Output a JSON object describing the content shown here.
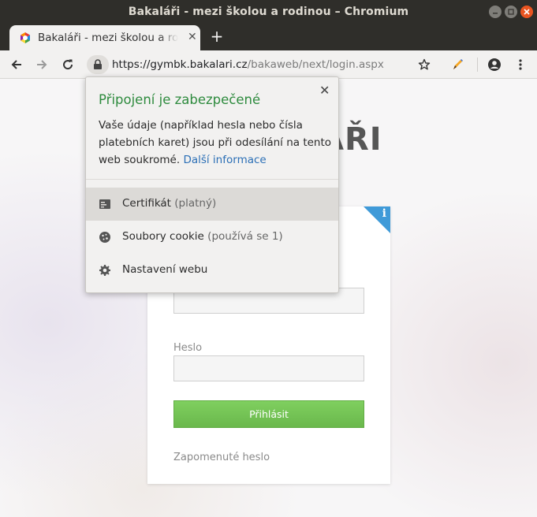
{
  "window": {
    "title": "Bakaláři - mezi školou a rodinou – Chromium"
  },
  "tab": {
    "title": "Bakaláři - mezi školou a rodinou",
    "close": "✕",
    "new_tab": "+"
  },
  "toolbar": {
    "url_host": "https://gymbk.bakalari.cz",
    "url_path": "/bakaweb/next/login.aspx"
  },
  "popup": {
    "title": "Připojení je zabezpečené",
    "close": "✕",
    "description": "Vaše údaje (například hesla nebo čísla platebních karet) jsou při odesílání na tento web soukromé.",
    "link": "Další informace",
    "items": [
      {
        "label": "Certifikát",
        "sub": "(platný)",
        "icon": "certificate-icon"
      },
      {
        "label": "Soubory cookie",
        "sub": "(používá se 1)",
        "icon": "cookie-icon"
      },
      {
        "label": "Nastavení webu",
        "sub": "",
        "icon": "gear-icon"
      }
    ]
  },
  "page": {
    "logo_partial": "ÁŘI",
    "info_badge": "i",
    "password_label": "Heslo",
    "login_button": "Přihlásit",
    "forgot_link": "Zapomenuté heslo"
  },
  "colors": {
    "popup_title": "#2e8b3e",
    "link": "#2b6fb6",
    "login_button": "#6ab84c",
    "info_corner": "#3f9ad8"
  }
}
